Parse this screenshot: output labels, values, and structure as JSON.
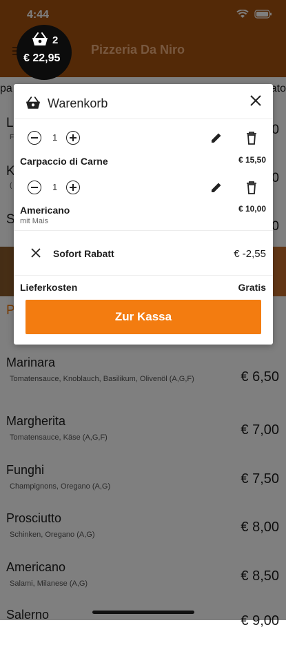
{
  "status": {
    "time": "4:44"
  },
  "header": {
    "title": "Pizzeria Da Niro"
  },
  "category_strip": {
    "left": "pa",
    "right": "ato"
  },
  "background_rows": [
    {
      "letter": "L",
      "sub": "F",
      "price": "0"
    },
    {
      "letter": "K",
      "sub": "(",
      "price": "0"
    },
    {
      "letter": "S",
      "sub": "",
      "price": "0"
    },
    {
      "letter": "P",
      "sub": "",
      "price": ""
    }
  ],
  "menu": [
    {
      "name": "Marinara",
      "desc": "Tomatensauce, Knoblauch, Basilikum, Olivenöl (A,G,F)",
      "price": "€ 6,50"
    },
    {
      "name": "Margherita",
      "desc": "Tomatensauce, Käse (A,G,F)",
      "price": "€ 7,00"
    },
    {
      "name": "Funghi",
      "desc": "Champignons, Oregano (A,G)",
      "price": "€ 7,50"
    },
    {
      "name": "Prosciutto",
      "desc": "Schinken, Oregano (A,G)",
      "price": "€ 8,00"
    },
    {
      "name": "Americano",
      "desc": "Salami, Milanese (A,G)",
      "price": "€ 8,50"
    },
    {
      "name": "Salerno",
      "desc": "",
      "price": "€ 9,00"
    }
  ],
  "cart_badge": {
    "count": "2",
    "total": "€ 22,95"
  },
  "cart": {
    "title": "Warenkorb",
    "items": [
      {
        "qty": "1",
        "name": "Carpaccio di Carne",
        "sub": "",
        "price": "€ 15,50"
      },
      {
        "qty": "1",
        "name": "Americano",
        "sub": "mit Mais",
        "price": "€ 10,00"
      }
    ],
    "discount": {
      "label": "Sofort Rabatt",
      "value": "€ -2,55"
    },
    "delivery": {
      "label": "Lieferkosten",
      "value": "Gratis"
    },
    "checkout_label": "Zur Kassa"
  },
  "colors": {
    "brand": "#a7520f",
    "accent": "#f37c10"
  }
}
